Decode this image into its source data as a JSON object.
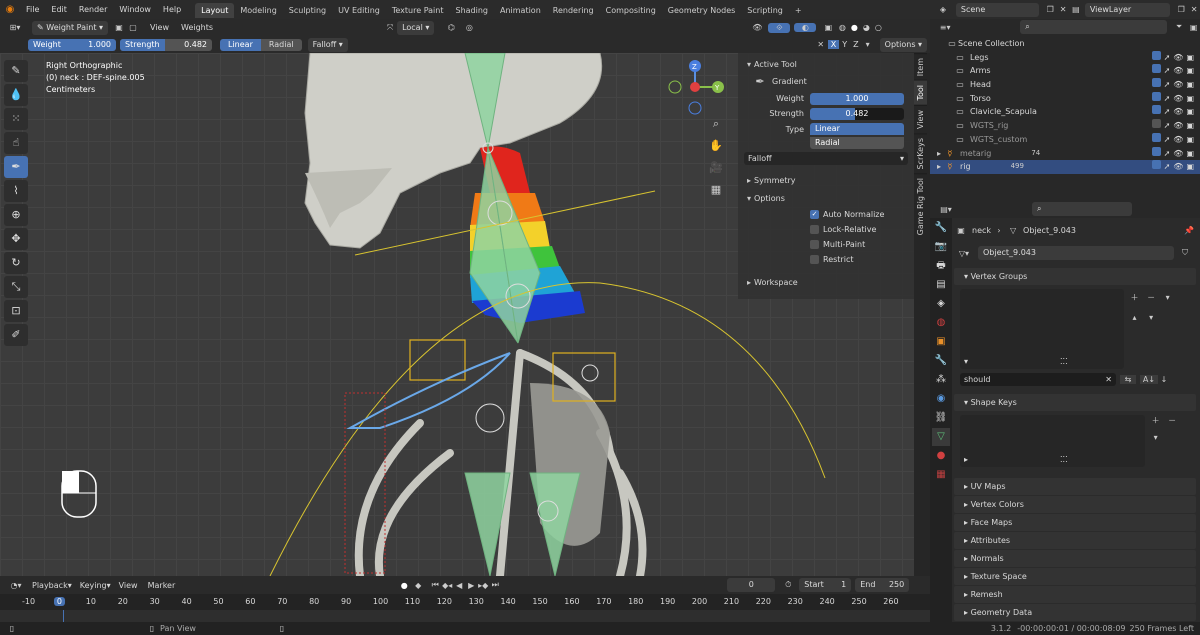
{
  "topbar": {
    "menus": [
      "File",
      "Edit",
      "Render",
      "Window",
      "Help"
    ],
    "workspaces": [
      "Layout",
      "Modeling",
      "Sculpting",
      "UV Editing",
      "Texture Paint",
      "Shading",
      "Animation",
      "Rendering",
      "Compositing",
      "Geometry Nodes",
      "Scripting"
    ],
    "active_workspace": "Layout",
    "add_tab": "+",
    "scene_label": "Scene",
    "view_layer_label": "ViewLayer"
  },
  "viewport_header": {
    "mode": "Weight Paint",
    "menus": [
      "View",
      "Weights"
    ],
    "orientation": "Local",
    "axes": [
      "X",
      "Y",
      "Z"
    ],
    "options": "Options"
  },
  "tool_header": {
    "weight_label": "Weight",
    "weight_value": "1.000",
    "strength_label": "Strength",
    "strength_value": "0.482",
    "linear": "Linear",
    "radial": "Radial",
    "falloff": "Falloff"
  },
  "viewport": {
    "view_name": "Right Orthographic",
    "active": "(0) neck : DEF-spine.005",
    "units": "Centimeters",
    "gizmo_axes": {
      "z": "Z",
      "y": "Y"
    }
  },
  "npanel": {
    "active_tool": "Active Tool",
    "tool_name": "Gradient",
    "weight_label": "Weight",
    "weight_value": "1.000",
    "strength_label": "Strength",
    "strength_value": "0.482",
    "type_label": "Type",
    "type_linear": "Linear",
    "type_radial": "Radial",
    "falloff": "Falloff",
    "symmetry": "Symmetry",
    "options": "Options",
    "auto_normalize": "Auto Normalize",
    "lock_relative": "Lock-Relative",
    "multi_paint": "Multi-Paint",
    "restrict": "Restrict",
    "workspace": "Workspace",
    "tabs": [
      "Item",
      "Tool",
      "View",
      "ScrKeys",
      "Game Rig Tool"
    ]
  },
  "outliner": {
    "root": "Scene Collection",
    "items": [
      {
        "name": "Legs",
        "selected": false
      },
      {
        "name": "Arms",
        "selected": false
      },
      {
        "name": "Head",
        "selected": false
      },
      {
        "name": "Torso",
        "selected": false
      },
      {
        "name": "Clavicle_Scapula",
        "selected": false
      },
      {
        "name": "WGTS_rig",
        "selected": false
      },
      {
        "name": "WGTS_custom",
        "selected": false
      },
      {
        "name": "metarig",
        "selected": false,
        "badge": "74"
      },
      {
        "name": "rig",
        "selected": true,
        "badge": "499"
      }
    ]
  },
  "properties": {
    "breadcrumb_object": "neck",
    "breadcrumb_data": "Object_9.043",
    "data_name": "Object_9.043",
    "vertex_groups": "Vertex Groups",
    "search_value": "should",
    "shape_keys": "Shape Keys",
    "sections": [
      "UV Maps",
      "Vertex Colors",
      "Face Maps",
      "Attributes",
      "Normals",
      "Texture Space",
      "Remesh",
      "Geometry Data"
    ]
  },
  "timeline": {
    "menus": [
      "Playback",
      "Keying",
      "View",
      "Marker"
    ],
    "current_frame": "0",
    "start_label": "Start",
    "start_value": "1",
    "end_label": "End",
    "end_value": "250",
    "ticks": [
      "-10",
      "0",
      "10",
      "20",
      "30",
      "40",
      "50",
      "60",
      "70",
      "80",
      "90",
      "100",
      "110",
      "120",
      "130",
      "140",
      "150",
      "160",
      "170",
      "180",
      "190",
      "200",
      "210",
      "220",
      "230",
      "240",
      "250",
      "260"
    ]
  },
  "status": {
    "hint": "Pan View",
    "version": "3.1.2",
    "timecode": "-00:00:00:01 / 00:00:08:09",
    "frames_left": "250 Frames Left"
  },
  "colors": {
    "accent": "#4772b3",
    "selection": "#334d80",
    "bone_green": "#8fd3a0",
    "curve_yellow": "#d8c430",
    "bg_panel": "#2b2b2b"
  }
}
